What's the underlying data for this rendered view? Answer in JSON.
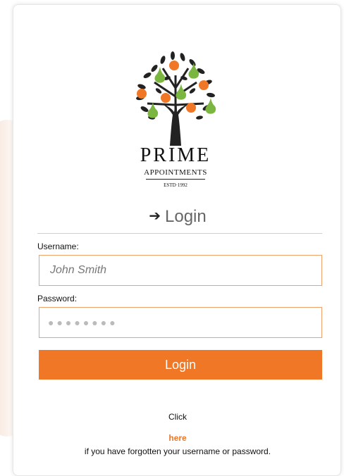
{
  "brand": {
    "name": "PRIME",
    "subtitle": "APPOINTMENTS",
    "established": "ESTD·1992",
    "colors": {
      "orange": "#ef7726",
      "green": "#7bb640",
      "dark": "#222222"
    }
  },
  "login": {
    "heading": "Login",
    "heading_icon": "sign-in-icon"
  },
  "form": {
    "username_label": "Username:",
    "username_placeholder": "John Smith",
    "password_label": "Password:",
    "password_value_mask": "●●●●●●●●",
    "submit_label": "Login"
  },
  "help": {
    "click": "Click",
    "here": "here",
    "forgot": "if you have forgotten your username or password."
  }
}
